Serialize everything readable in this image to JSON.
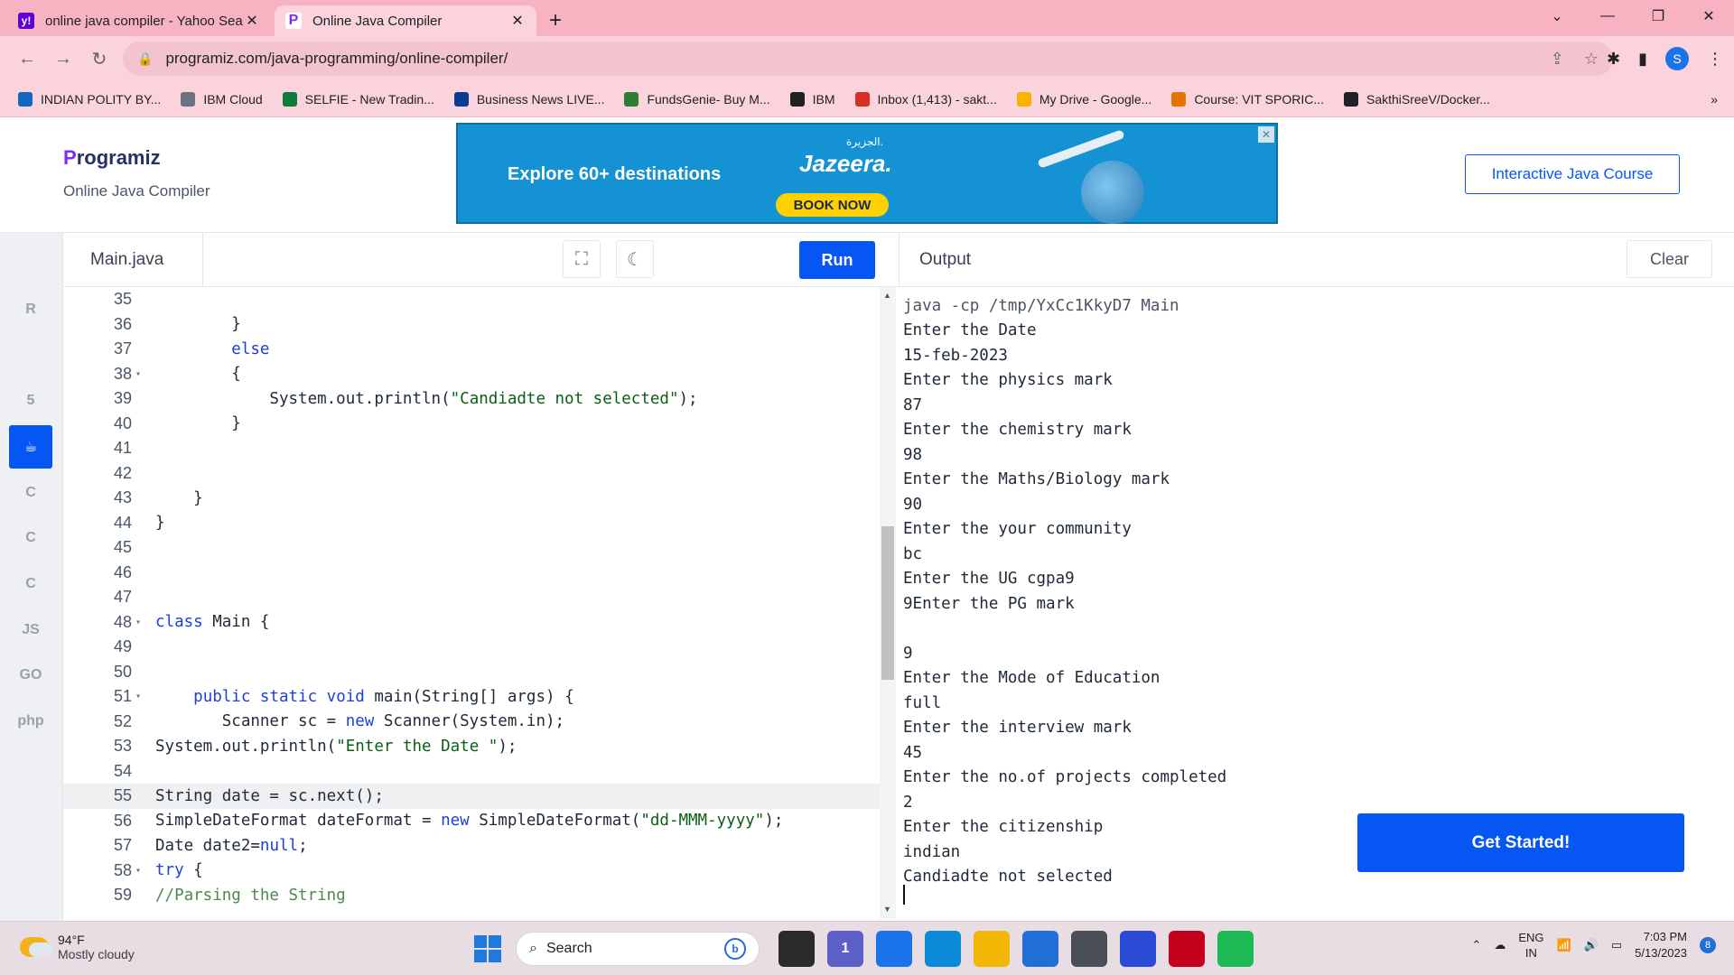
{
  "browser": {
    "tabs": [
      {
        "title": "online java compiler - Yahoo Sea",
        "favicon_color": "#5f01d1",
        "favicon_letter": "y!",
        "active": false
      },
      {
        "title": "Online Java Compiler",
        "favicon_color": "#7b2cff",
        "favicon_letter": "P",
        "active": true
      }
    ],
    "url": "programiz.com/java-programming/online-compiler/",
    "profile_initial": "S",
    "bookmarks": [
      {
        "label": "INDIAN POLITY BY...",
        "color": "#1565c0"
      },
      {
        "label": "IBM Cloud",
        "color": "#6b7280"
      },
      {
        "label": "SELFIE - New Tradin...",
        "color": "#0f7a3c"
      },
      {
        "label": "Business News LIVE...",
        "color": "#0a3d91"
      },
      {
        "label": "FundsGenie- Buy M...",
        "color": "#2e7d32"
      },
      {
        "label": "IBM",
        "color": "#202124"
      },
      {
        "label": "Inbox (1,413) - sakt...",
        "color": "#d93025"
      },
      {
        "label": "My Drive - Google...",
        "color": "#f4b400"
      },
      {
        "label": "Course: VIT SPORIC...",
        "color": "#e37400"
      },
      {
        "label": "SakthiSreeV/Docker...",
        "color": "#202124"
      }
    ],
    "bookmarks_more": "»"
  },
  "site": {
    "logo": "Programiz",
    "subtitle": "Online Java Compiler",
    "course_button": "Interactive Java Course",
    "ad": {
      "headline": "Explore 60+ destinations",
      "brand": "Jazeera.",
      "brand_arabic": "الجزيرة.",
      "cta": "BOOK NOW"
    }
  },
  "sidebar": {
    "items": [
      {
        "label": "",
        "icon": "python-icon",
        "active": false
      },
      {
        "label": "R",
        "icon": "r-lang-icon",
        "active": false
      },
      {
        "label": "",
        "icon": "database-icon",
        "active": false
      },
      {
        "label": "5",
        "icon": "html5-icon",
        "active": false
      },
      {
        "label": "☕",
        "icon": "java-icon",
        "active": true
      },
      {
        "label": "C",
        "icon": "c-icon",
        "active": false
      },
      {
        "label": "C",
        "icon": "cpp-icon",
        "active": false
      },
      {
        "label": "C",
        "icon": "csharp-icon",
        "active": false
      },
      {
        "label": "JS",
        "icon": "javascript-icon",
        "active": false
      },
      {
        "label": "GO",
        "icon": "go-icon",
        "active": false
      },
      {
        "label": "php",
        "icon": "php-icon",
        "active": false
      },
      {
        "label": "",
        "icon": "swift-icon",
        "active": false
      }
    ]
  },
  "editor": {
    "file_name": "Main.java",
    "run_label": "Run",
    "lines": [
      {
        "n": "35",
        "fold": false,
        "segs": [
          {
            "t": "",
            "c": ""
          }
        ]
      },
      {
        "n": "36",
        "fold": false,
        "segs": [
          {
            "t": "        }",
            "c": ""
          }
        ]
      },
      {
        "n": "37",
        "fold": false,
        "segs": [
          {
            "t": "        ",
            "c": ""
          },
          {
            "t": "else",
            "c": "kw"
          }
        ]
      },
      {
        "n": "38",
        "fold": true,
        "segs": [
          {
            "t": "        {",
            "c": ""
          }
        ]
      },
      {
        "n": "39",
        "fold": false,
        "segs": [
          {
            "t": "            System.out.println(",
            "c": ""
          },
          {
            "t": "\"Candiadte not selected\"",
            "c": "str"
          },
          {
            "t": ");",
            "c": ""
          }
        ]
      },
      {
        "n": "40",
        "fold": false,
        "segs": [
          {
            "t": "        }",
            "c": ""
          }
        ]
      },
      {
        "n": "41",
        "fold": false,
        "segs": [
          {
            "t": "",
            "c": ""
          }
        ]
      },
      {
        "n": "42",
        "fold": false,
        "segs": [
          {
            "t": "",
            "c": ""
          }
        ]
      },
      {
        "n": "43",
        "fold": false,
        "segs": [
          {
            "t": "    }",
            "c": ""
          }
        ]
      },
      {
        "n": "44",
        "fold": false,
        "segs": [
          {
            "t": "}",
            "c": ""
          }
        ]
      },
      {
        "n": "45",
        "fold": false,
        "segs": [
          {
            "t": "",
            "c": ""
          }
        ]
      },
      {
        "n": "46",
        "fold": false,
        "segs": [
          {
            "t": "",
            "c": ""
          }
        ]
      },
      {
        "n": "47",
        "fold": false,
        "segs": [
          {
            "t": "",
            "c": ""
          }
        ]
      },
      {
        "n": "48",
        "fold": true,
        "segs": [
          {
            "t": "class",
            "c": "kw"
          },
          {
            "t": " Main {",
            "c": ""
          }
        ]
      },
      {
        "n": "49",
        "fold": false,
        "segs": [
          {
            "t": "",
            "c": ""
          }
        ]
      },
      {
        "n": "50",
        "fold": false,
        "segs": [
          {
            "t": "",
            "c": ""
          }
        ]
      },
      {
        "n": "51",
        "fold": true,
        "segs": [
          {
            "t": "    ",
            "c": ""
          },
          {
            "t": "public static void",
            "c": "kw"
          },
          {
            "t": " main(String[] args) {",
            "c": ""
          }
        ]
      },
      {
        "n": "52",
        "fold": false,
        "segs": [
          {
            "t": "       Scanner sc = ",
            "c": ""
          },
          {
            "t": "new",
            "c": "kw"
          },
          {
            "t": " Scanner(System.in);",
            "c": ""
          }
        ]
      },
      {
        "n": "53",
        "fold": false,
        "segs": [
          {
            "t": "System.out.println(",
            "c": ""
          },
          {
            "t": "\"Enter the Date \"",
            "c": "str"
          },
          {
            "t": ");",
            "c": ""
          }
        ]
      },
      {
        "n": "54",
        "fold": false,
        "segs": [
          {
            "t": "",
            "c": ""
          }
        ]
      },
      {
        "n": "55",
        "fold": false,
        "highlight": true,
        "segs": [
          {
            "t": "String date = sc.next();",
            "c": ""
          }
        ]
      },
      {
        "n": "56",
        "fold": false,
        "segs": [
          {
            "t": "SimpleDateFormat dateFormat = ",
            "c": ""
          },
          {
            "t": "new",
            "c": "kw"
          },
          {
            "t": " SimpleDateFormat(",
            "c": ""
          },
          {
            "t": "\"dd-MMM-yyyy\"",
            "c": "str"
          },
          {
            "t": ");",
            "c": ""
          }
        ]
      },
      {
        "n": "57",
        "fold": false,
        "segs": [
          {
            "t": "Date date2=",
            "c": ""
          },
          {
            "t": "null",
            "c": "kw"
          },
          {
            "t": ";",
            "c": ""
          }
        ]
      },
      {
        "n": "58",
        "fold": true,
        "segs": [
          {
            "t": "try",
            "c": "kw"
          },
          {
            "t": " {",
            "c": ""
          }
        ]
      },
      {
        "n": "59",
        "fold": false,
        "segs": [
          {
            "t": "//Parsing the String",
            "c": "cm"
          }
        ]
      }
    ]
  },
  "output": {
    "title": "Output",
    "clear_label": "Clear",
    "lines": [
      "java -cp /tmp/YxCc1KkyD7 Main",
      "Enter the Date",
      "15-feb-2023",
      "Enter the physics mark",
      "87",
      "Enter the chemistry mark",
      "98",
      "Enter the Maths/Biology mark",
      "90",
      "Enter the your community",
      "bc",
      "Enter the UG cgpa9",
      "9Enter the PG mark",
      "",
      "9",
      "Enter the Mode of Education",
      "full",
      "Enter the interview mark",
      "45",
      "Enter the no.of projects completed",
      "2",
      "Enter the citizenship",
      "indian",
      "Candiadte not selected"
    ],
    "cta": "Get Started!"
  },
  "taskbar": {
    "temperature": "94°F",
    "weather": "Mostly cloudy",
    "search_placeholder": "Search",
    "lang_top": "ENG",
    "lang_bottom": "IN",
    "time": "7:03 PM",
    "date": "5/13/2023",
    "notifications": "8",
    "apps": [
      {
        "name": "file-explorer-dark",
        "color": "#2b2b2b",
        "label": ""
      },
      {
        "name": "teams-icon",
        "color": "#5b5fc7",
        "label": "1"
      },
      {
        "name": "chrome-icon",
        "color": "#1a73e8",
        "label": ""
      },
      {
        "name": "edge-icon",
        "color": "#0c8bd8",
        "label": ""
      },
      {
        "name": "folder-icon",
        "color": "#f2b705",
        "label": ""
      },
      {
        "name": "store-icon",
        "color": "#1f6fd6",
        "label": ""
      },
      {
        "name": "virtualbox-icon",
        "color": "#4a4f57",
        "label": ""
      },
      {
        "name": "vscode-style-icon",
        "color": "#2a4bd6",
        "label": ""
      },
      {
        "name": "mcafee-icon",
        "color": "#c4001a",
        "label": ""
      },
      {
        "name": "spotify-icon",
        "color": "#1db954",
        "label": ""
      }
    ]
  }
}
